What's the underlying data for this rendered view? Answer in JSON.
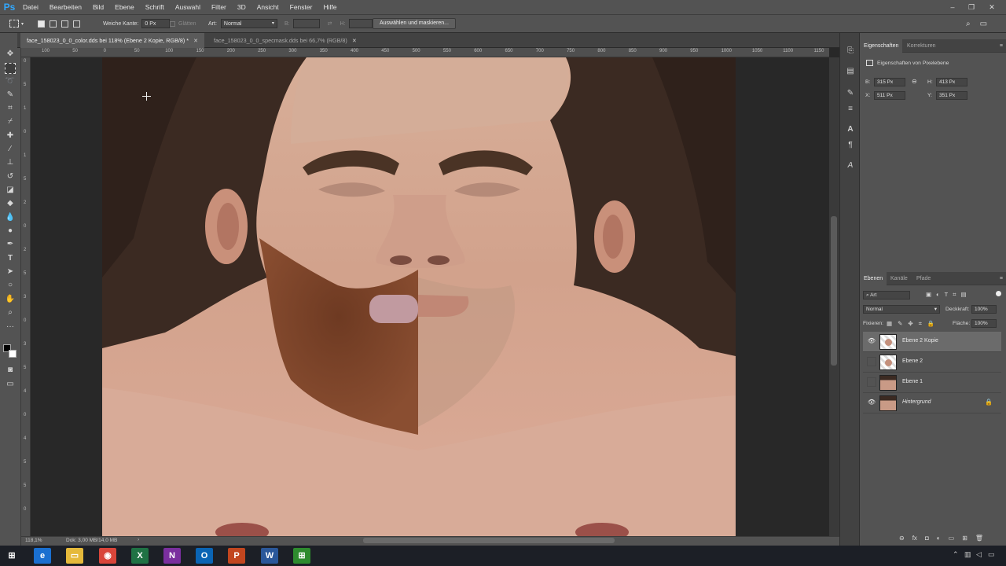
{
  "app": {
    "logo": "Ps"
  },
  "menu": [
    "Datei",
    "Bearbeiten",
    "Bild",
    "Ebene",
    "Schrift",
    "Auswahl",
    "Filter",
    "3D",
    "Ansicht",
    "Fenster",
    "Hilfe"
  ],
  "window_controls": {
    "minimize": "‒",
    "restore": "❐",
    "close": "✕"
  },
  "options": {
    "feather_label": "Weiche Kante:",
    "feather_value": "0 Px",
    "antialias_label": "Glätten",
    "style_label": "Art:",
    "style_value": "Normal",
    "width_label": "B:",
    "height_label": "H:",
    "select_mask_button": "Auswählen und maskieren..."
  },
  "tabs": [
    {
      "label": "face_158023_0_0_color.dds bei 118% (Ebene 2 Kopie, RGB/8) *",
      "close": "✕"
    },
    {
      "label": "face_158023_0_0_specmask.dds bei 66,7% (RGB/8)",
      "close": "✕"
    }
  ],
  "ruler_top": [
    "100",
    "50",
    "0",
    "50",
    "100",
    "150",
    "200",
    "250",
    "300",
    "350",
    "400",
    "450",
    "500",
    "550",
    "600",
    "650",
    "700",
    "750",
    "800",
    "850",
    "900",
    "950",
    "1000",
    "1050",
    "1100",
    "1150"
  ],
  "ruler_left": [
    "0",
    "5",
    "1",
    "0",
    "1",
    "5",
    "2",
    "0",
    "2",
    "5",
    "3",
    "0",
    "3",
    "5",
    "4",
    "0",
    "4",
    "5",
    "5",
    "0"
  ],
  "status": {
    "zoom": "118,1%",
    "doc": "Dok: 3,00 MB/14,0 MB"
  },
  "properties": {
    "tabs": [
      "Eigenschaften",
      "Korrekturen"
    ],
    "title": "Eigenschaften von Pixelebene",
    "w_label": "B:",
    "w_value": "315 Px",
    "h_label": "H:",
    "h_value": "413 Px",
    "x_label": "X:",
    "x_value": "511 Px",
    "y_label": "Y:",
    "y_value": "351 Px"
  },
  "layers_panel": {
    "tabs": [
      "Ebenen",
      "Kanäle",
      "Pfade"
    ],
    "filter": "Art",
    "blend_mode": "Normal",
    "opacity_label": "Deckkraft:",
    "opacity_value": "100%",
    "lock_label": "Fixieren:",
    "fill_label": "Fläche:",
    "fill_value": "100%",
    "layers": [
      {
        "name": "Ebene 2 Kopie",
        "visible": true,
        "selected": true
      },
      {
        "name": "Ebene 2",
        "visible": false,
        "selected": false
      },
      {
        "name": "Ebene 1",
        "visible": false,
        "selected": false
      },
      {
        "name": "Hintergrund",
        "visible": true,
        "selected": false,
        "locked": true
      }
    ]
  },
  "taskbar": {
    "apps": [
      {
        "icon": "windows-start-icon",
        "glyph": "⊞",
        "color": "#1c1f26"
      },
      {
        "icon": "edge-icon",
        "glyph": "e",
        "color": "#1a6fd0"
      },
      {
        "icon": "file-explorer-icon",
        "glyph": "▭",
        "color": "#e5b93b"
      },
      {
        "icon": "chrome-icon",
        "glyph": "◉",
        "color": "#d9453a"
      },
      {
        "icon": "excel-icon",
        "glyph": "X",
        "color": "#1f7244"
      },
      {
        "icon": "onenote-icon",
        "glyph": "N",
        "color": "#7a2f9e"
      },
      {
        "icon": "outlook-icon",
        "glyph": "O",
        "color": "#0a64b4"
      },
      {
        "icon": "powerpoint-icon",
        "glyph": "P",
        "color": "#c2461f"
      },
      {
        "icon": "word-icon",
        "glyph": "W",
        "color": "#2a579a"
      },
      {
        "icon": "project-icon",
        "glyph": "⊞",
        "color": "#2e8b2e"
      }
    ]
  }
}
